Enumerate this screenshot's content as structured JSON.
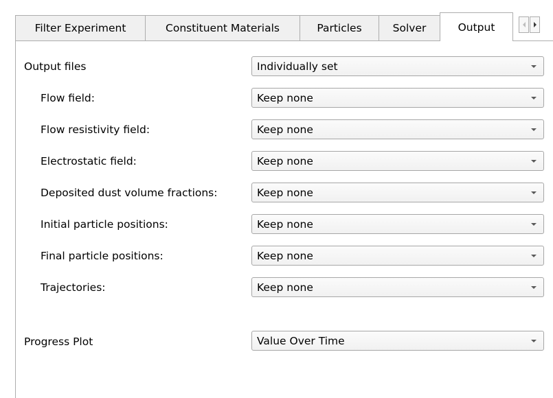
{
  "tabs": [
    {
      "label": "Filter Experiment",
      "active": false
    },
    {
      "label": "Constituent Materials",
      "active": false
    },
    {
      "label": "Particles",
      "active": false
    },
    {
      "label": "Solver",
      "active": false
    },
    {
      "label": "Output",
      "active": true
    }
  ],
  "output": {
    "output_files": {
      "label": "Output files",
      "value": "Individually set"
    },
    "fields": [
      {
        "label": "Flow field:",
        "value": "Keep none"
      },
      {
        "label": "Flow resistivity field:",
        "value": "Keep none"
      },
      {
        "label": "Electrostatic field:",
        "value": "Keep none"
      },
      {
        "label": "Deposited dust volume fractions:",
        "value": "Keep none"
      },
      {
        "label": "Initial particle positions:",
        "value": "Keep none"
      },
      {
        "label": "Final particle positions:",
        "value": "Keep none"
      },
      {
        "label": "Trajectories:",
        "value": "Keep none"
      }
    ],
    "progress_plot": {
      "label": "Progress Plot",
      "value": "Value Over Time"
    }
  },
  "icons": {
    "tab_scroll_left": "triangle-left-icon",
    "tab_scroll_right": "triangle-right-icon",
    "dropdown_arrow": "chevron-down-icon"
  }
}
